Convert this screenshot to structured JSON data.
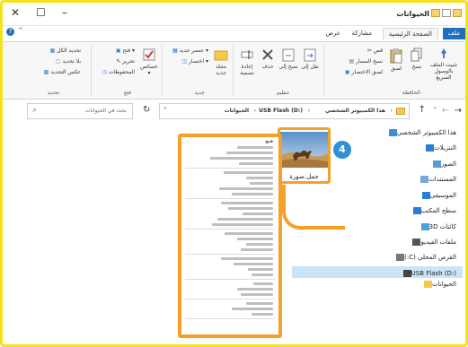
{
  "window": {
    "title": "الحيوانات",
    "min": "–",
    "max": "☐",
    "close": "✕"
  },
  "tabs": {
    "file": "ملف",
    "home": "الصفحة الرئيسية",
    "share": "مشاركة",
    "view": "عرض"
  },
  "ribbon": {
    "clipboard": {
      "label": "الحافظة",
      "pin": "تثبيت الملف بالوصول السريع",
      "copy": "نسخ",
      "paste": "لصق",
      "cut": "قص",
      "copy_path": "نسخ المسار",
      "paste_shortcut": "لصق الاختصار"
    },
    "organize": {
      "label": "تنظيم",
      "move_to": "نقل إلى",
      "copy_to": "نسخ إلى",
      "delete": "حذف",
      "rename": "إعادة تسمية"
    },
    "new": {
      "label": "جديد",
      "new_folder": "مجلد جديد",
      "new_item": "عنصر جديد",
      "easy_access": "اختصار"
    },
    "open": {
      "label": "فتح",
      "properties": "خصائص",
      "open": "فتح",
      "edit": "تحرير",
      "history": "المحفوظات"
    },
    "select": {
      "label": "تحديد",
      "select_all": "تحديد الكل",
      "select_none": "بلا تحديد",
      "invert": "عكس التحديد"
    }
  },
  "nav": {
    "path_pc": "هذا الكمبيوتر الشخصي",
    "path_usb": "USB Flash (D:)",
    "path_folder": "الحيوانات",
    "search_placeholder": "بحث في الحيوانات"
  },
  "sidebar": {
    "items": [
      {
        "label": "هذا الكمبيوتر الشخصي",
        "icon": "pc-icon",
        "color": "#3b8fd6"
      },
      {
        "label": "التنزيلات",
        "icon": "download-icon",
        "color": "#2a7fd4"
      },
      {
        "label": "الصور",
        "icon": "pictures-icon",
        "color": "#5b9bd5"
      },
      {
        "label": "المستندات",
        "icon": "documents-icon",
        "color": "#7aa7d8"
      },
      {
        "label": "الموسيقى",
        "icon": "music-icon",
        "color": "#2a7fd4"
      },
      {
        "label": "سطح المكتب",
        "icon": "desktop-icon",
        "color": "#2a7fd4"
      },
      {
        "label": "كائنات 3D",
        "icon": "3d-icon",
        "color": "#4aa3df"
      },
      {
        "label": "ملفات الفيديو",
        "icon": "video-icon",
        "color": "#555"
      },
      {
        "label": "القرص المحلي (C:)",
        "icon": "drive-icon",
        "color": "#777"
      },
      {
        "label": "USB Flash (D:)",
        "icon": "usb-icon",
        "color": "#444"
      },
      {
        "label": "الحيوانات",
        "icon": "folder-icon",
        "color": "#f6c84c"
      }
    ]
  },
  "file": {
    "name": "جمل.صورة"
  },
  "callout": {
    "number": "4"
  },
  "menu": {
    "first": "فتح"
  }
}
